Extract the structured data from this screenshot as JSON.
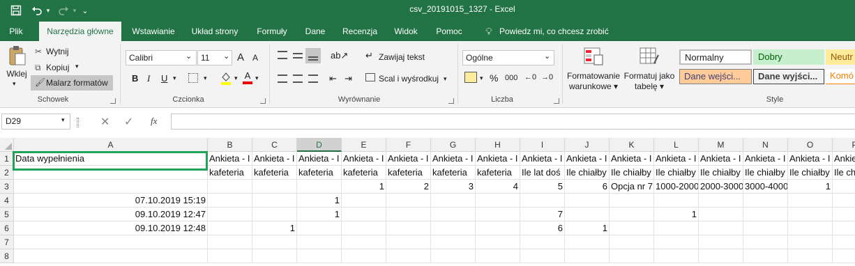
{
  "titlebar": {
    "title": "csv_20191015_1327  -  Excel",
    "save_icon": "save-icon",
    "undo_icon": "undo-icon",
    "redo_icon": "redo-icon"
  },
  "tabs": [
    "Plik",
    "Narzędzia główne",
    "Wstawianie",
    "Układ strony",
    "Formuły",
    "Dane",
    "Recenzja",
    "Widok",
    "Pomoc"
  ],
  "tell_me": "Powiedz mi, co chcesz zrobić",
  "clipboard": {
    "paste": "Wklej",
    "cut": "Wytnij",
    "copy": "Kopiuj",
    "format_painter": "Malarz formatów",
    "label": "Schowek"
  },
  "font": {
    "name": "Calibri",
    "size": "11",
    "label": "Czcionka",
    "bold": "B",
    "italic": "I",
    "underline": "U",
    "grow": "A",
    "shrink": "A"
  },
  "alignment": {
    "wrap": "Zawijaj tekst",
    "merge": "Scal i wyśrodkuj",
    "label": "Wyrównanie"
  },
  "number": {
    "format": "Ogólne",
    "label": "Liczba",
    "percent": "%",
    "comma": "000"
  },
  "styles": {
    "cond_format_1": "Formatowanie",
    "cond_format_2": "warunkowe",
    "format_table_1": "Formatuj jako",
    "format_table_2": "tabelę",
    "normal": "Normalny",
    "good": "Dobry",
    "neutral": "Neutr",
    "input": "Dane wejści...",
    "output": "Dane wyjści...",
    "comment": "Komó",
    "label": "Style"
  },
  "formula_bar": {
    "name_box": "D29",
    "fx": "fx"
  },
  "grid": {
    "columns": [
      "A",
      "B",
      "C",
      "D",
      "E",
      "F",
      "G",
      "H",
      "I",
      "J",
      "K",
      "L",
      "M",
      "N",
      "O",
      "P"
    ],
    "rows": [
      "1",
      "2",
      "3",
      "4",
      "5",
      "6",
      "7",
      "8"
    ],
    "selected_column": "D",
    "row1": [
      "Data wypełnienia",
      "Ankieta - I",
      "Ankieta - I",
      "Ankieta - I",
      "Ankieta - I",
      "Ankieta - I",
      "Ankieta - I",
      "Ankieta - I",
      "Ankieta - I",
      "Ankieta - I",
      "Ankieta - I",
      "Ankieta - I",
      "Ankieta - I",
      "Ankieta - I",
      "Ankieta - I",
      "Ankieta - I"
    ],
    "row2": [
      "",
      "kafeteria",
      "kafeteria",
      "kafeteria",
      "kafeteria",
      "kafeteria",
      "kafeteria",
      "kafeteria",
      "Ile lat doś",
      "Ile chiałby",
      "Ile chiałby",
      "Ile chiałby",
      "Ile chiałby",
      "Ile chiałby",
      "Ile chiałby",
      "Ile chi"
    ],
    "row3": [
      "",
      "",
      "",
      "",
      "1",
      "2",
      "3",
      "4",
      "5",
      "6",
      "Opcja nr 7",
      "1000-2000",
      "2000-3000",
      "3000-4000",
      "1",
      ""
    ],
    "row4": [
      "07.10.2019 15:19",
      "",
      "",
      "1",
      "",
      "",
      "",
      "",
      "",
      "",
      "",
      "",
      "",
      "",
      "",
      ""
    ],
    "row5": [
      "09.10.2019 12:47",
      "",
      "",
      "1",
      "",
      "",
      "",
      "",
      "7",
      "",
      "",
      "1",
      "",
      "",
      "",
      ""
    ],
    "row6": [
      "09.10.2019 12:48",
      "",
      "1",
      "",
      "",
      "",
      "",
      "",
      "6",
      "1",
      "",
      "",
      "",
      "",
      "",
      ""
    ],
    "row7": [
      "",
      "",
      "",
      "",
      "",
      "",
      "",
      "",
      "",
      "",
      "",
      "",
      "",
      "",
      "",
      ""
    ],
    "row8": [
      "",
      "",
      "",
      "",
      "",
      "",
      "",
      "",
      "",
      "",
      "",
      "",
      "",
      "",
      "",
      ""
    ]
  },
  "colors": {
    "excel_green": "#217346",
    "good_bg": "#c6efce",
    "good_fg": "#006100",
    "neutral_bg": "#ffeb9c",
    "neutral_fg": "#9c5700",
    "input_bg": "#ffcc99",
    "input_fg": "#3f3f76"
  }
}
